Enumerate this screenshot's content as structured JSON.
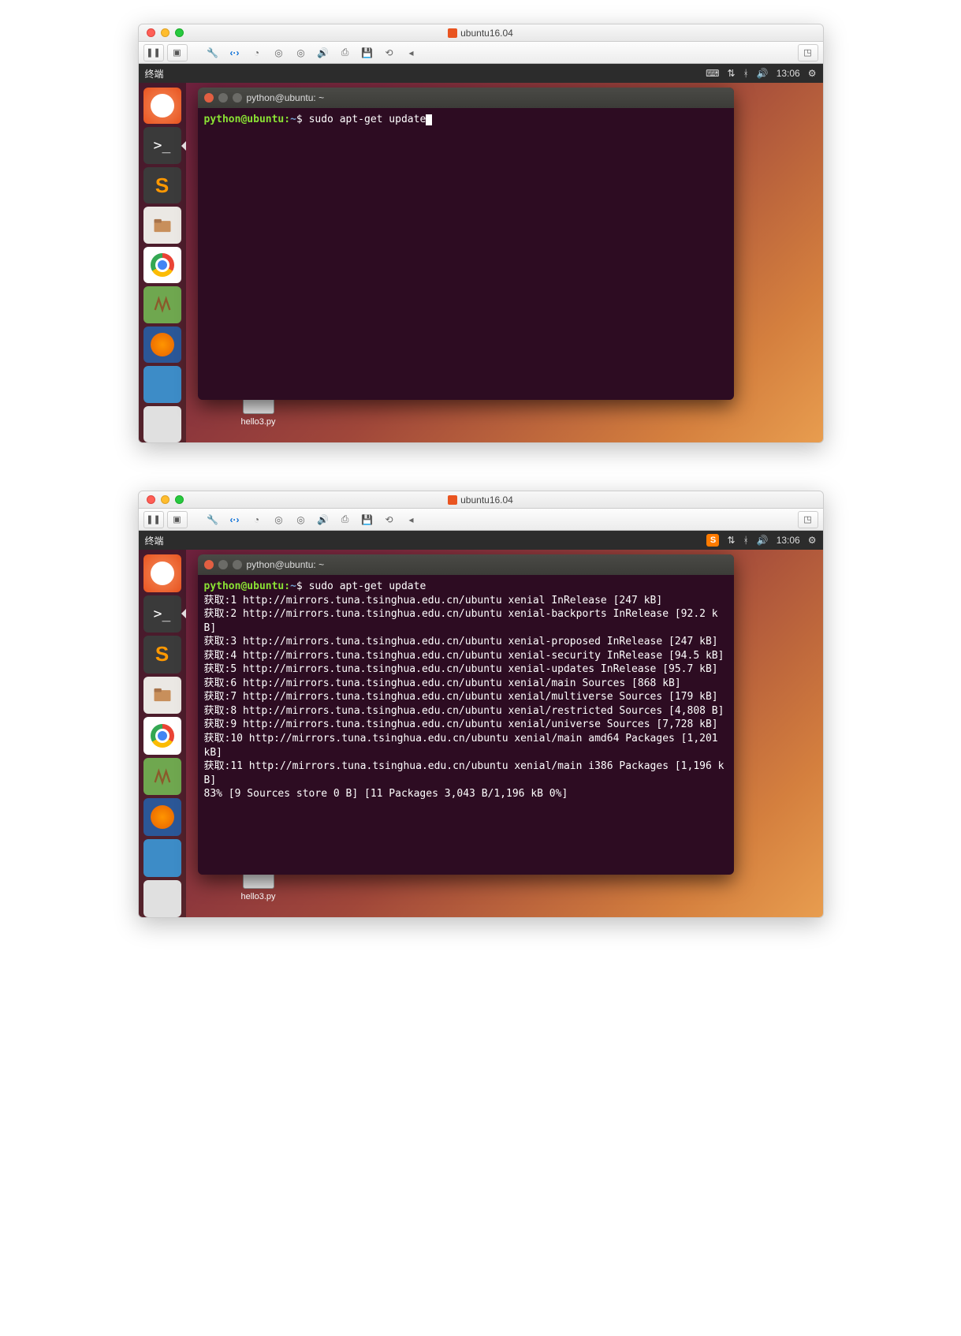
{
  "mac_title": "ubuntu16.04",
  "ubuntu": {
    "menubar_left": "终端",
    "clock": "13:06",
    "desktop_file": "hello3.py"
  },
  "terminal": {
    "title": "python@ubuntu: ~",
    "prompt_user": "python@ubuntu",
    "prompt_sep": ":",
    "prompt_path": "~",
    "prompt_char": "$",
    "command": "sudo apt-get update"
  },
  "apt_output": [
    "获取:1 http://mirrors.tuna.tsinghua.edu.cn/ubuntu xenial InRelease [247 kB]",
    "获取:2 http://mirrors.tuna.tsinghua.edu.cn/ubuntu xenial-backports InRelease [92.2 kB]",
    "获取:3 http://mirrors.tuna.tsinghua.edu.cn/ubuntu xenial-proposed InRelease [247 kB]",
    "获取:4 http://mirrors.tuna.tsinghua.edu.cn/ubuntu xenial-security InRelease [94.5 kB]",
    "获取:5 http://mirrors.tuna.tsinghua.edu.cn/ubuntu xenial-updates InRelease [95.7 kB]",
    "获取:6 http://mirrors.tuna.tsinghua.edu.cn/ubuntu xenial/main Sources [868 kB]",
    "获取:7 http://mirrors.tuna.tsinghua.edu.cn/ubuntu xenial/multiverse Sources [179 kB]",
    "获取:8 http://mirrors.tuna.tsinghua.edu.cn/ubuntu xenial/restricted Sources [4,808 B]",
    "获取:9 http://mirrors.tuna.tsinghua.edu.cn/ubuntu xenial/universe Sources [7,728 kB]",
    "获取:10 http://mirrors.tuna.tsinghua.edu.cn/ubuntu xenial/main amd64 Packages [1,201 kB]",
    "获取:11 http://mirrors.tuna.tsinghua.edu.cn/ubuntu xenial/main i386 Packages [1,196 kB]",
    "83% [9 Sources store 0 B] [11 Packages 3,043 B/1,196 kB 0%]"
  ]
}
